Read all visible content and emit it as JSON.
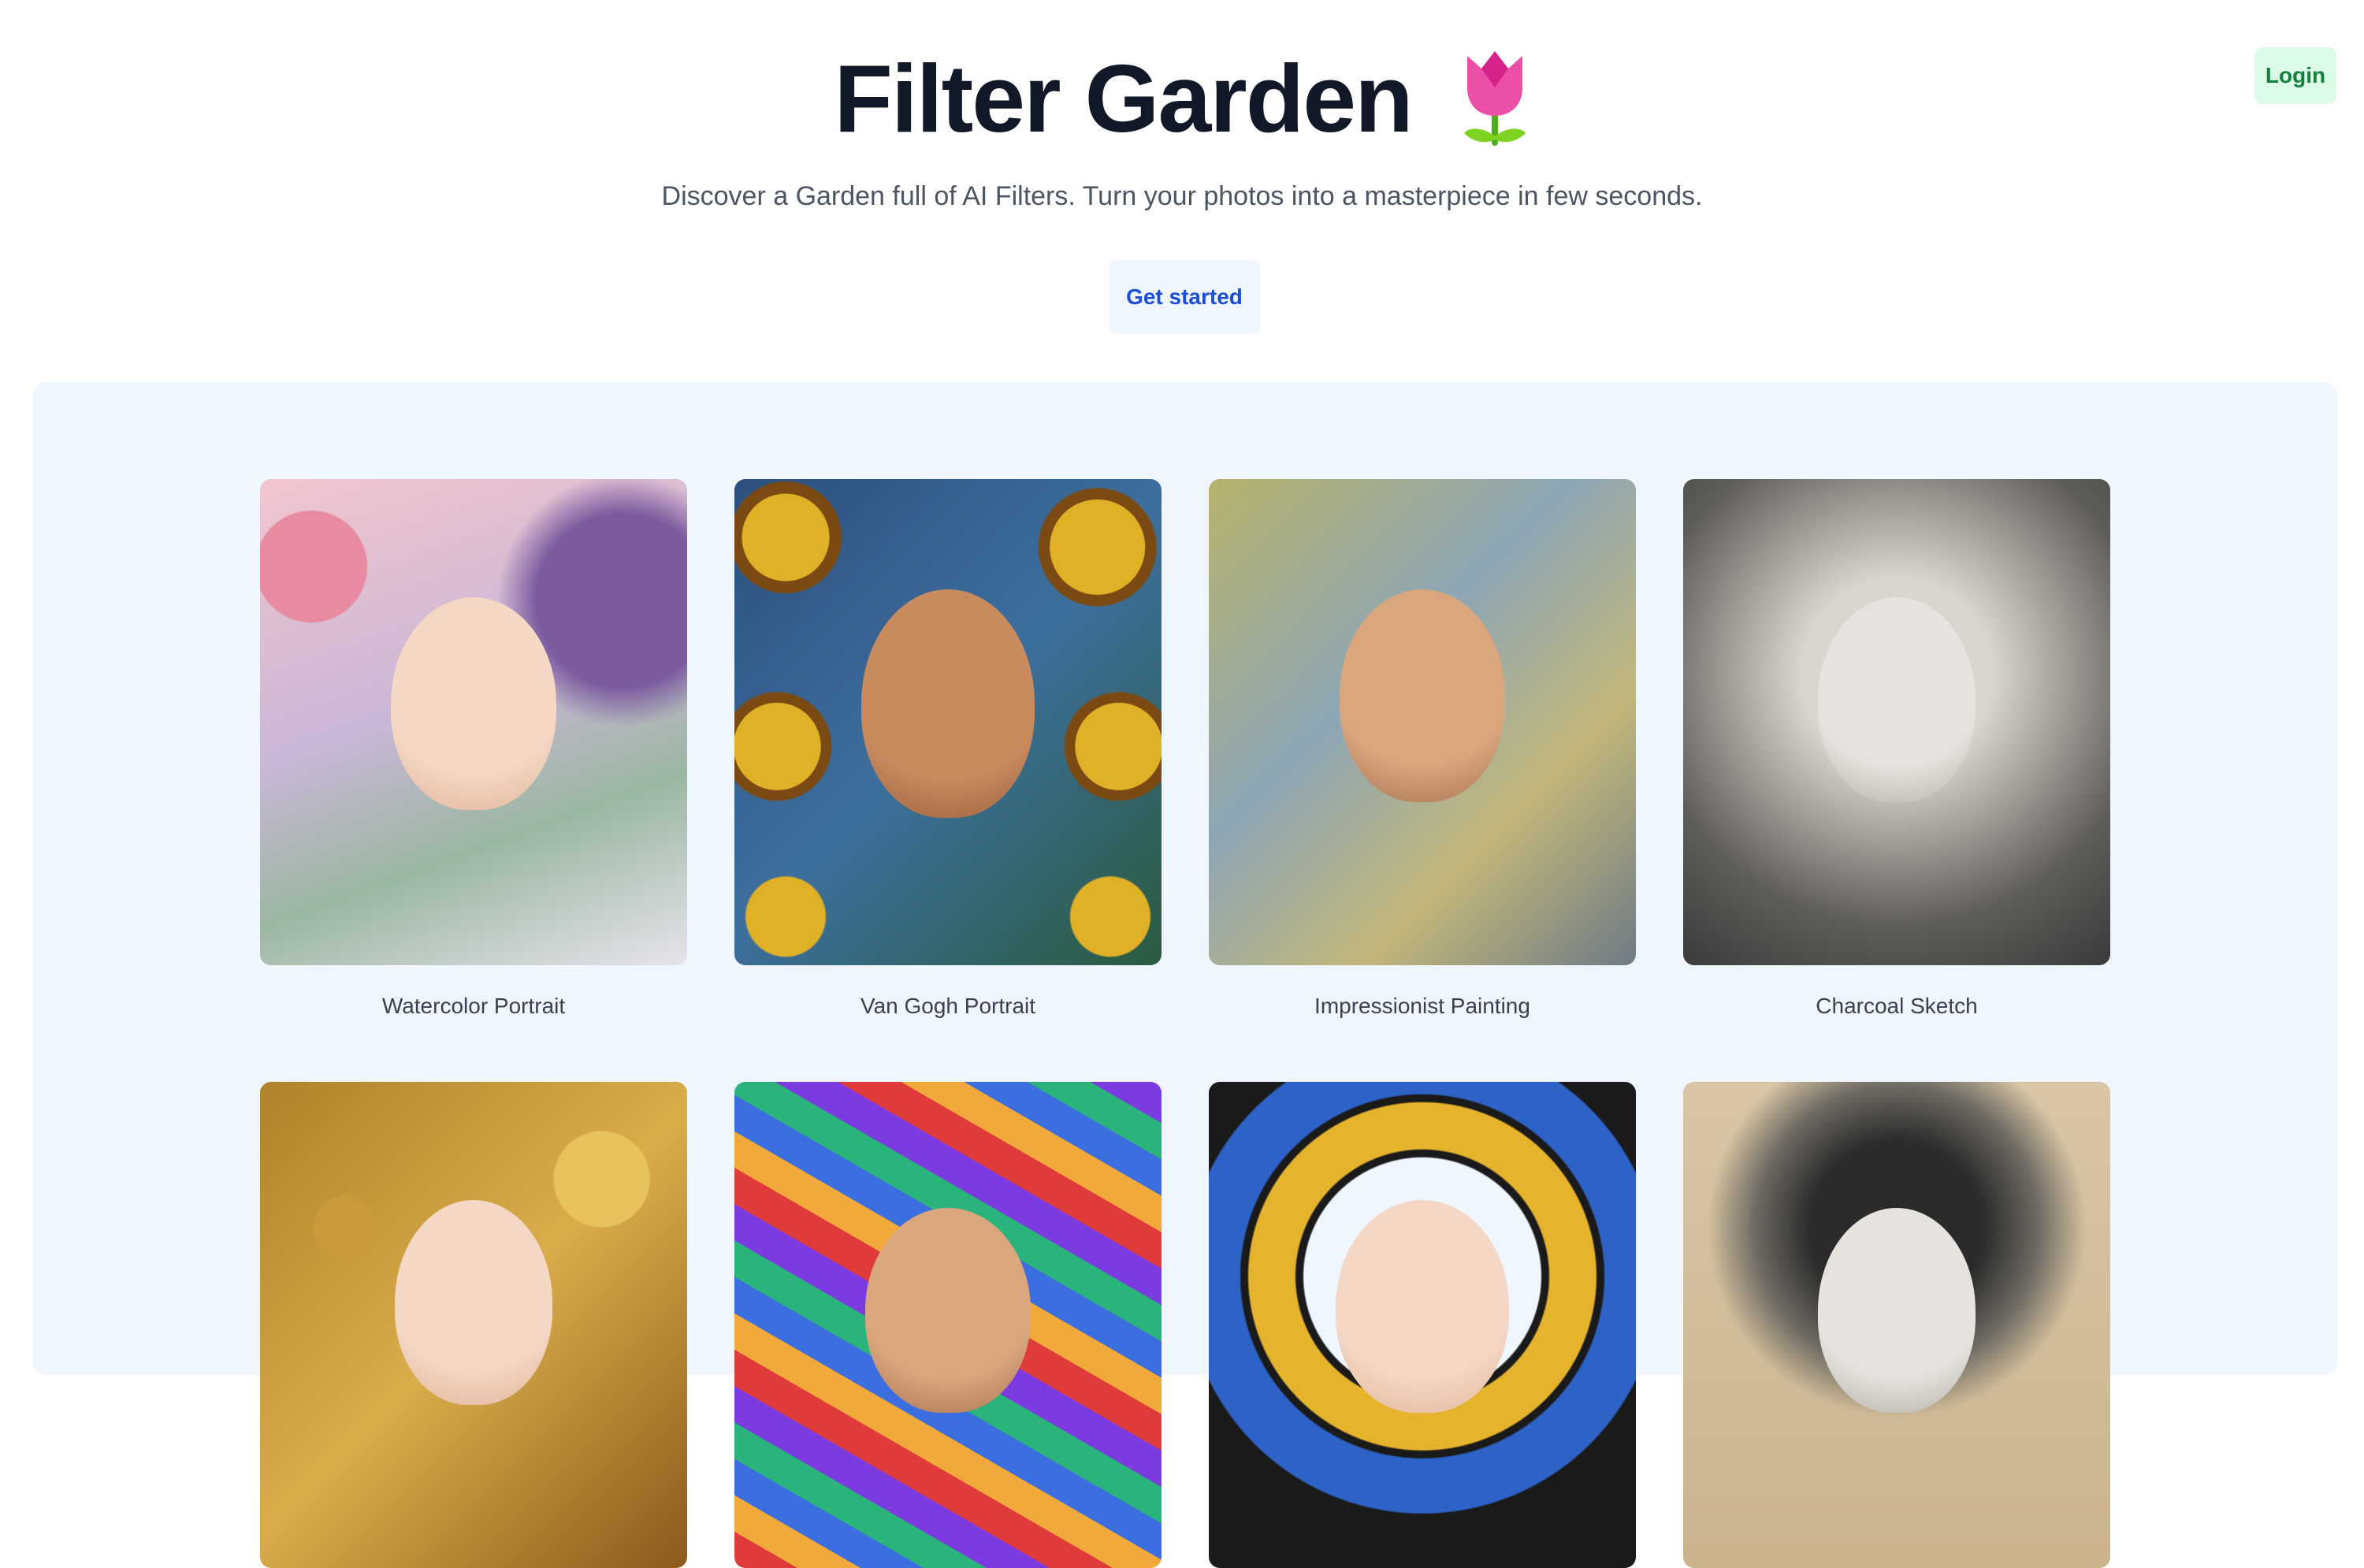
{
  "header": {
    "title": "Filter Garden",
    "title_icon": "tulip-icon",
    "subtitle": "Discover a Garden full of AI Filters. Turn your photos into a masterpiece in few seconds.",
    "cta_label": "Get started",
    "login_label": "Login"
  },
  "colors": {
    "login_bg": "#dcfce7",
    "login_text": "#15803d",
    "cta_bg": "#eff6ff",
    "cta_text": "#1d4ed8",
    "gallery_bg": "#eff6ff"
  },
  "filters": [
    {
      "label": "Watercolor Portrait"
    },
    {
      "label": "Van Gogh Portrait"
    },
    {
      "label": "Impressionist Painting"
    },
    {
      "label": "Charcoal Sketch"
    },
    {
      "label": ""
    },
    {
      "label": ""
    },
    {
      "label": ""
    },
    {
      "label": ""
    }
  ]
}
